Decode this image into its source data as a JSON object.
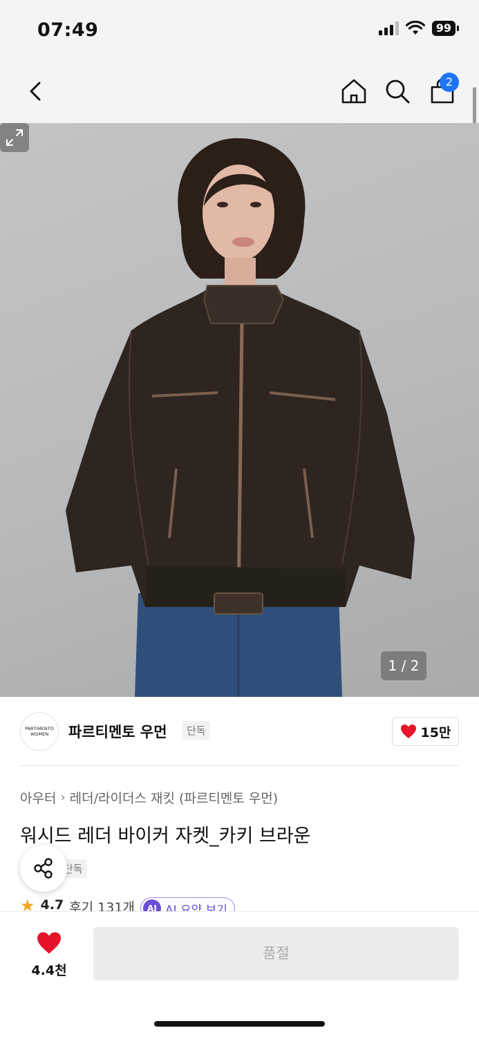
{
  "status_bar": {
    "time": "07:49",
    "battery": "99"
  },
  "nav": {
    "cart_count": "2"
  },
  "gallery": {
    "counter": "1 / 2"
  },
  "brand": {
    "logo_line1": "PARTIMENTO",
    "logo_line2": "WOMEN",
    "name": "파르티멘토 우먼",
    "tag": "단독",
    "likes": "15만"
  },
  "product": {
    "breadcrumb_parent": "아우터",
    "breadcrumb_child": "레더/라이더스 재킷 (파르티멘토 우먼)",
    "title": "워시드 레더 바이커 자켓_카키 브라운",
    "exclusive_tag": "단독",
    "rating": "4.7",
    "review_label": "후기 131개",
    "ai_badge": "AI",
    "ai_summary_label": "AI 요약 보기"
  },
  "bottom": {
    "wish_count": "4.4천",
    "soldout_label": "품절"
  },
  "colors": {
    "accent_blue": "#1d74f5",
    "heart_red": "#e8132b",
    "ai_purple": "#6a4fd8",
    "star_orange": "#f5a623"
  }
}
